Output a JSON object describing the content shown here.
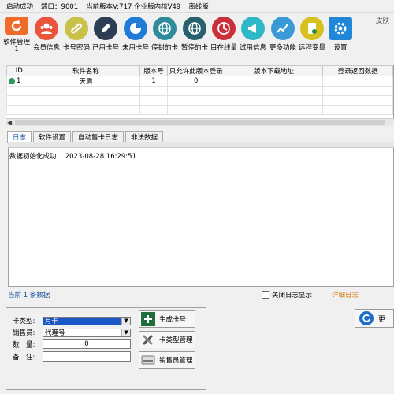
{
  "status": {
    "launch": "启动成功",
    "port_label": "端口：",
    "port": "9001",
    "version": "当前版本V:717 企业版内核V49",
    "edition": "离线版"
  },
  "corner_text": "皮肤",
  "toolbar": [
    {
      "label": "软件管理",
      "sub": "1",
      "icon": "refresh-icon",
      "color": "#f06a2a"
    },
    {
      "label": "会员信息",
      "icon": "members-icon",
      "color": "#e8553a"
    },
    {
      "label": "卡号密码",
      "icon": "key-link-icon",
      "color": "#c9c24a"
    },
    {
      "label": "已用卡号",
      "icon": "pen-icon",
      "color": "#2d3d54"
    },
    {
      "label": "未用卡号",
      "icon": "pie-icon",
      "color": "#1f7ad8"
    },
    {
      "label": "停封的卡",
      "icon": "globe-icon",
      "color": "#2f8c9a"
    },
    {
      "label": "暂停的卡",
      "icon": "globe-icon",
      "color": "#28606e"
    },
    {
      "label": "目在线量",
      "icon": "clock-icon",
      "color": "#c9303a"
    },
    {
      "label": "试用信息",
      "icon": "megaphone-icon",
      "color": "#2fb8c8"
    },
    {
      "label": "更多功能",
      "icon": "chart-icon",
      "color": "#3a9ad8"
    },
    {
      "label": "远程变量",
      "icon": "doc-icon",
      "color": "#d8c020"
    },
    {
      "label": "设置",
      "icon": "gear-icon",
      "color": "#1f86d8"
    }
  ],
  "grid": {
    "columns": [
      "ID",
      "软件名称",
      "版本号",
      "只允许此版本登录",
      "版本下载地址",
      "登录返回数据"
    ],
    "rows": [
      {
        "id": "1",
        "name": "天盾",
        "version": "1",
        "only_this": "0",
        "url": "",
        "ret": ""
      }
    ]
  },
  "log_tabs": [
    "日志",
    "软件设置",
    "自动售卡日志",
    "非法数据"
  ],
  "log_line": "数据初始化成功！ 2023-08-28 16:29:51",
  "footer": {
    "count": "当前 1 条数据",
    "checkbox_label": "关闭日志显示",
    "detail": "详细日志"
  },
  "form": {
    "card_type_label": "卡类型:",
    "card_type_value": "月卡",
    "seller_label": "销售员:",
    "seller_value": "代理号",
    "quantity_label": "数　量:",
    "quantity_value": "0",
    "note_label": "备　注:",
    "note_value": ""
  },
  "buttons": {
    "generate": "生成卡号",
    "card_type_mgmt": "卡类型管理",
    "seller_mgmt": "销售员管理",
    "right_partial": "更"
  }
}
